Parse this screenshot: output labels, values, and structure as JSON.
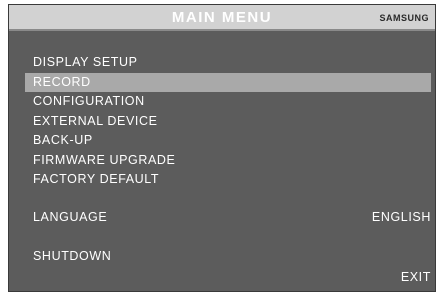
{
  "header": {
    "title": "MAIN MENU",
    "brand": "SAMSUNG"
  },
  "menu": {
    "items": [
      {
        "label": "DISPLAY SETUP"
      },
      {
        "label": "RECORD",
        "selected": true
      },
      {
        "label": "CONFIGURATION"
      },
      {
        "label": "EXTERNAL DEVICE"
      },
      {
        "label": "BACK-UP"
      },
      {
        "label": "FIRMWARE UPGRADE"
      },
      {
        "label": "FACTORY DEFAULT"
      }
    ]
  },
  "language": {
    "label": "LANGUAGE",
    "value": "ENGLISH"
  },
  "shutdown": {
    "label": "SHUTDOWN"
  },
  "exit": {
    "label": "EXIT"
  },
  "colors": {
    "background": "#5c5c5c",
    "header": "#d2d2d2",
    "selection": "#a9a9a9",
    "text": "#ffffff"
  }
}
